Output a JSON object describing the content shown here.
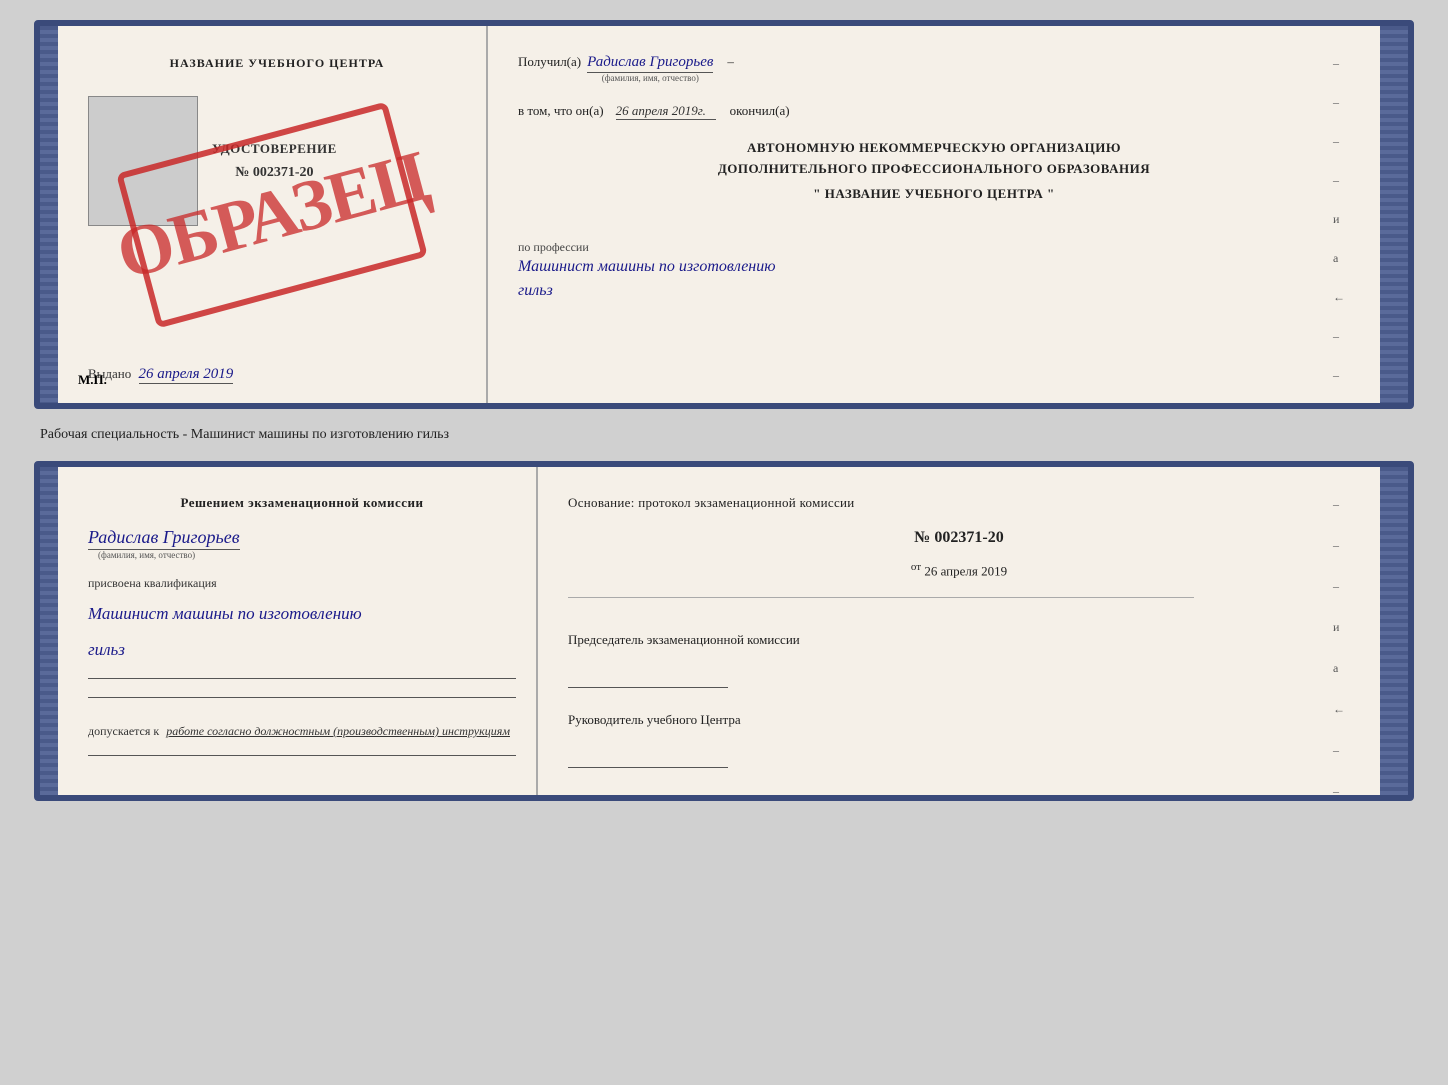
{
  "top_card": {
    "left": {
      "title": "НАЗВАНИЕ УЧЕБНОГО ЦЕНТРА",
      "cert_label": "УДОСТОВЕРЕНИЕ",
      "cert_number": "№ 002371-20",
      "vydano_label": "Выдано",
      "vydano_date": "26 апреля 2019",
      "mp_label": "М.П.",
      "stamp_text": "ОБРАЗЕЦ"
    },
    "right": {
      "poluchil_label": "Получил(а)",
      "recipient_name": "Радислав Григорьев",
      "fio_sublabel": "(фамилия, имя, отчество)",
      "vtom_label": "в том, что он(а)",
      "vtom_date": "26 апреля 2019г.",
      "okanchil_label": "окончил(а)",
      "org_line1": "АВТОНОМНУЮ НЕКОММЕРЧЕСКУЮ ОРГАНИЗАЦИЮ",
      "org_line2": "ДОПОЛНИТЕЛЬНОГО ПРОФЕССИОНАЛЬНОГО ОБРАЗОВАНИЯ",
      "org_name": "\" НАЗВАНИЕ УЧЕБНОГО ЦЕНТРА \"",
      "po_professii_label": "по профессии",
      "profession_line1": "Машинист машины по изготовлению",
      "profession_line2": "гильз"
    }
  },
  "between_label": "Рабочая специальность - Машинист машины по изготовлению гильз",
  "bottom_card": {
    "left": {
      "resheniyem_label": "Решением экзаменационной комиссии",
      "recipient_name": "Радислав Григорьев",
      "fio_sublabel": "(фамилия, имя, отчество)",
      "prisvoena_label": "присвоена квалификация",
      "qualification_line1": "Машинист машины по изготовлению",
      "qualification_line2": "гильз",
      "dopuskaetsya_prefix": "допускается к",
      "dopuskaetsya_text": "работе согласно должностным (производственным) инструкциям"
    },
    "right": {
      "osnovanie_label": "Основание: протокол экзаменационной комиссии",
      "proto_number": "№ 002371-20",
      "ot_label": "от",
      "proto_date": "26 апреля 2019",
      "predsedatel_label": "Председатель экзаменационной комиссии",
      "rukovoditel_label": "Руководитель учебного Центра"
    }
  },
  "dashes": [
    "-",
    "-",
    "-",
    "-",
    "и",
    "а",
    "←",
    "-",
    "-",
    "-"
  ]
}
